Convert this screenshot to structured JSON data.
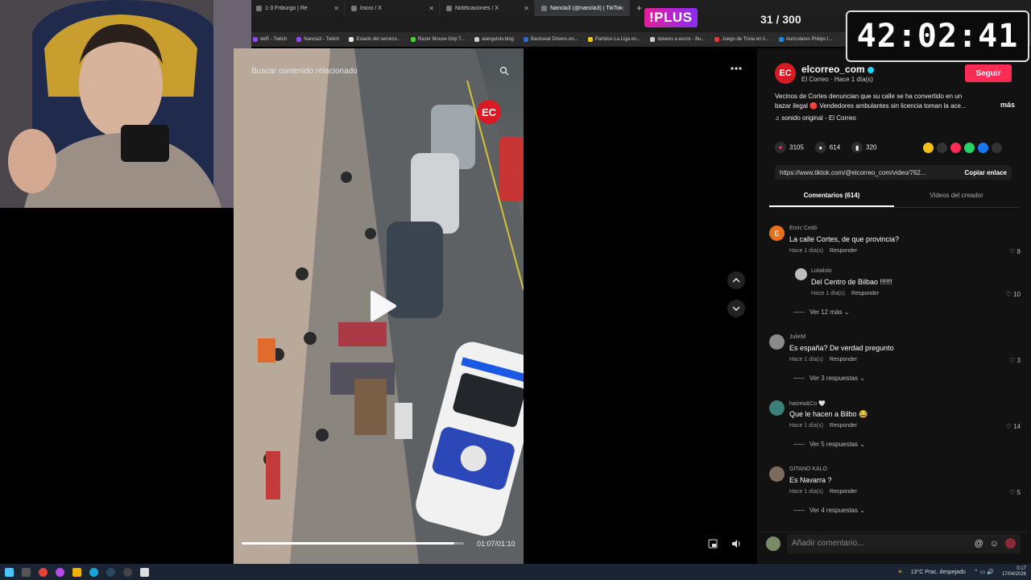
{
  "browser": {
    "tabs": [
      {
        "label": "1-3 Friburgo | Re",
        "icon": "tab-site-icon",
        "active": false
      },
      {
        "label": "Inicio / X",
        "icon": "x-logo-icon",
        "active": false
      },
      {
        "label": "Notificaciones / X",
        "icon": "x-logo-icon",
        "active": false
      },
      {
        "label": "Nancla3 (@nancla3) | TikTok",
        "icon": "tiktok-icon",
        "active": true
      }
    ],
    "new_tab": "+",
    "bookmarks": [
      {
        "label": "deR - Twitch",
        "color": "#9146ff"
      },
      {
        "label": "Nancla3 - Twitch",
        "color": "#9146ff"
      },
      {
        "label": "Estado del servicio...",
        "color": "#e6e6e6"
      },
      {
        "label": "Razer Mouse Grip T...",
        "color": "#44d62c"
      },
      {
        "label": "alangulotv.blog",
        "color": "#cccccc"
      },
      {
        "label": "Backseat Drivers en...",
        "color": "#2a6cd6"
      },
      {
        "label": "Partidos La Liga en...",
        "color": "#f0c419"
      },
      {
        "label": "dolares a euros - Bu...",
        "color": "#cccccc"
      },
      {
        "label": "Juego de Trivia en li...",
        "color": "#e53935"
      },
      {
        "label": "Auriculares Philips I...",
        "color": "#1e88e5"
      }
    ]
  },
  "overlay": {
    "plus_logo": "!PLUS",
    "counter": "31 / 300",
    "timer": "42:02:41"
  },
  "video": {
    "search_placeholder": "Buscar contenido relacionado",
    "channel_badge": "EC",
    "time": "01:07/01:10",
    "progress": 0.957
  },
  "post": {
    "avatar": "EC",
    "author": "elcorreo_com",
    "subtitle": "El Correo · Hace 1 día(s)",
    "follow": "Seguir",
    "description_line1": "Vecinos de Cortes denuncian que su calle se ha convertido en un",
    "description_line2": "bazar ilegal 🔴 Vendedores ambulantes sin licencia toman la ace...",
    "more": "más",
    "sound": "sonido original - El Correo",
    "likes": "3105",
    "comments": "614",
    "saves": "320",
    "link": "https://www.tiktok.com/@elcorreo_com/video/762...",
    "copy_link": "Copiar enlace"
  },
  "tabs": {
    "comments": "Comentarios (614)",
    "creator_videos": "Videos del creador"
  },
  "comments": [
    {
      "user": "Enric Cedó",
      "avatar_letter": "E",
      "avatar_color": "#e8711e",
      "text": "La calle Cortes, de que provincia?",
      "time": "Hace 1 día(s)",
      "reply": "Responder",
      "likes": "8"
    },
    {
      "user": "Lolailolo",
      "avatar_letter": "",
      "avatar_color": "#bdbdbd",
      "text": "Del Centro de Bilbao !!!!!!",
      "time": "Hace 1 día(s)",
      "reply": "Responder",
      "likes": "10",
      "nested": true
    },
    {
      "more": "Ver 12 más"
    },
    {
      "user": "JulieM",
      "avatar_letter": "",
      "avatar_color": "#8a8a8a",
      "text": "Es españa? De verdad pregunto",
      "time": "Hace 1 día(s)",
      "reply": "Responder",
      "likes": "3"
    },
    {
      "more": "Ver 3 respuestas"
    },
    {
      "user": "haizea&Co 🤍",
      "avatar_letter": "",
      "avatar_color": "#3a7f7a",
      "text": "Que le hacen a Bilbo 😂",
      "time": "Hace 1 día(s)",
      "reply": "Responder",
      "likes": "14"
    },
    {
      "more": "Ver 5 respuestas"
    },
    {
      "user": "GITANO KALO",
      "avatar_letter": "",
      "avatar_color": "#7a6b5e",
      "text": "Es Navarra ?",
      "time": "Hace 1 día(s)",
      "reply": "Responder",
      "likes": "5"
    },
    {
      "more": "Ver 4 respuestas"
    }
  ],
  "comment_input": {
    "placeholder": "Añadir comentario..."
  },
  "taskbar": {
    "weather": "13°C  Prac. despejado",
    "time": "0:17",
    "date": "17/04/2026"
  }
}
